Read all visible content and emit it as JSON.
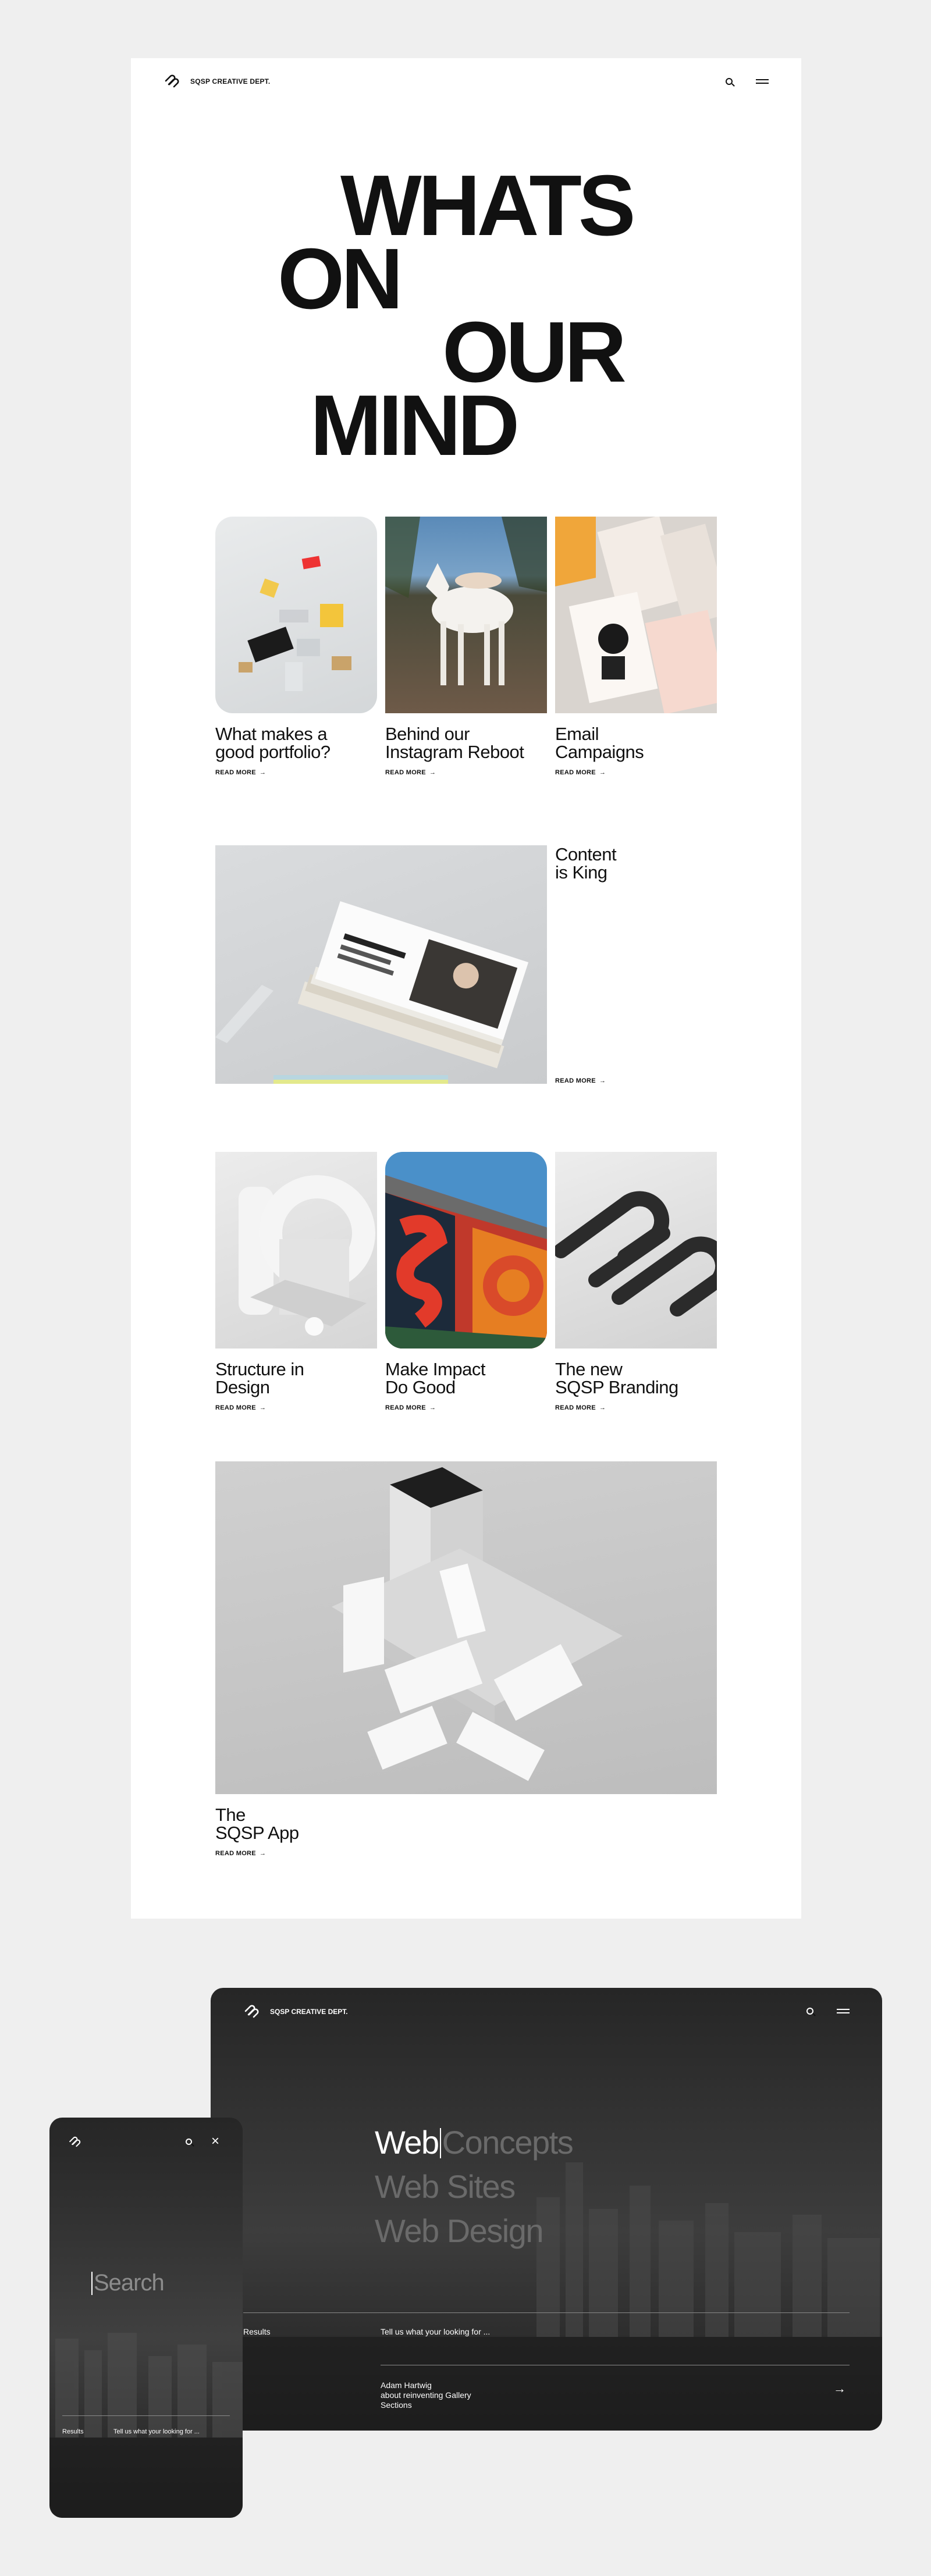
{
  "header": {
    "brand": "SQSP CREATIVE DEPT."
  },
  "hero": {
    "line1": "WHATS",
    "line2": "ON",
    "line3": "OUR",
    "line4": "MIND"
  },
  "read_more": "READ MORE",
  "row1": [
    {
      "title_a": "What makes a",
      "title_b": "good portfolio?"
    },
    {
      "title_a": "Behind our",
      "title_b": "Instagram Reboot"
    },
    {
      "title_a": "Email",
      "title_b": "Campaigns"
    }
  ],
  "feature": {
    "title_a": "Content",
    "title_b": "is King"
  },
  "row2": [
    {
      "title_a": "Structure in",
      "title_b": "Design"
    },
    {
      "title_a": "Make Impact",
      "title_b": "Do Good"
    },
    {
      "title_a": "The new",
      "title_b": "SQSP Branding"
    }
  ],
  "app": {
    "title_a": "The",
    "title_b": "SQSP App"
  },
  "desktop": {
    "brand": "SQSP CREATIVE DEPT.",
    "search_typed": "Web",
    "search_suggest": "Concepts",
    "suggestions": [
      "Web Sites",
      "Web Design"
    ],
    "results_label": "Results",
    "results_hint": "Tell us what your looking for ...",
    "result_line1": "Adam Hartwig",
    "result_line2": "about reinventing Gallery",
    "result_line3": "Sections"
  },
  "mobile": {
    "search_placeholder": "Search",
    "results_label": "Results",
    "results_hint": "Tell us what your looking for ..."
  }
}
